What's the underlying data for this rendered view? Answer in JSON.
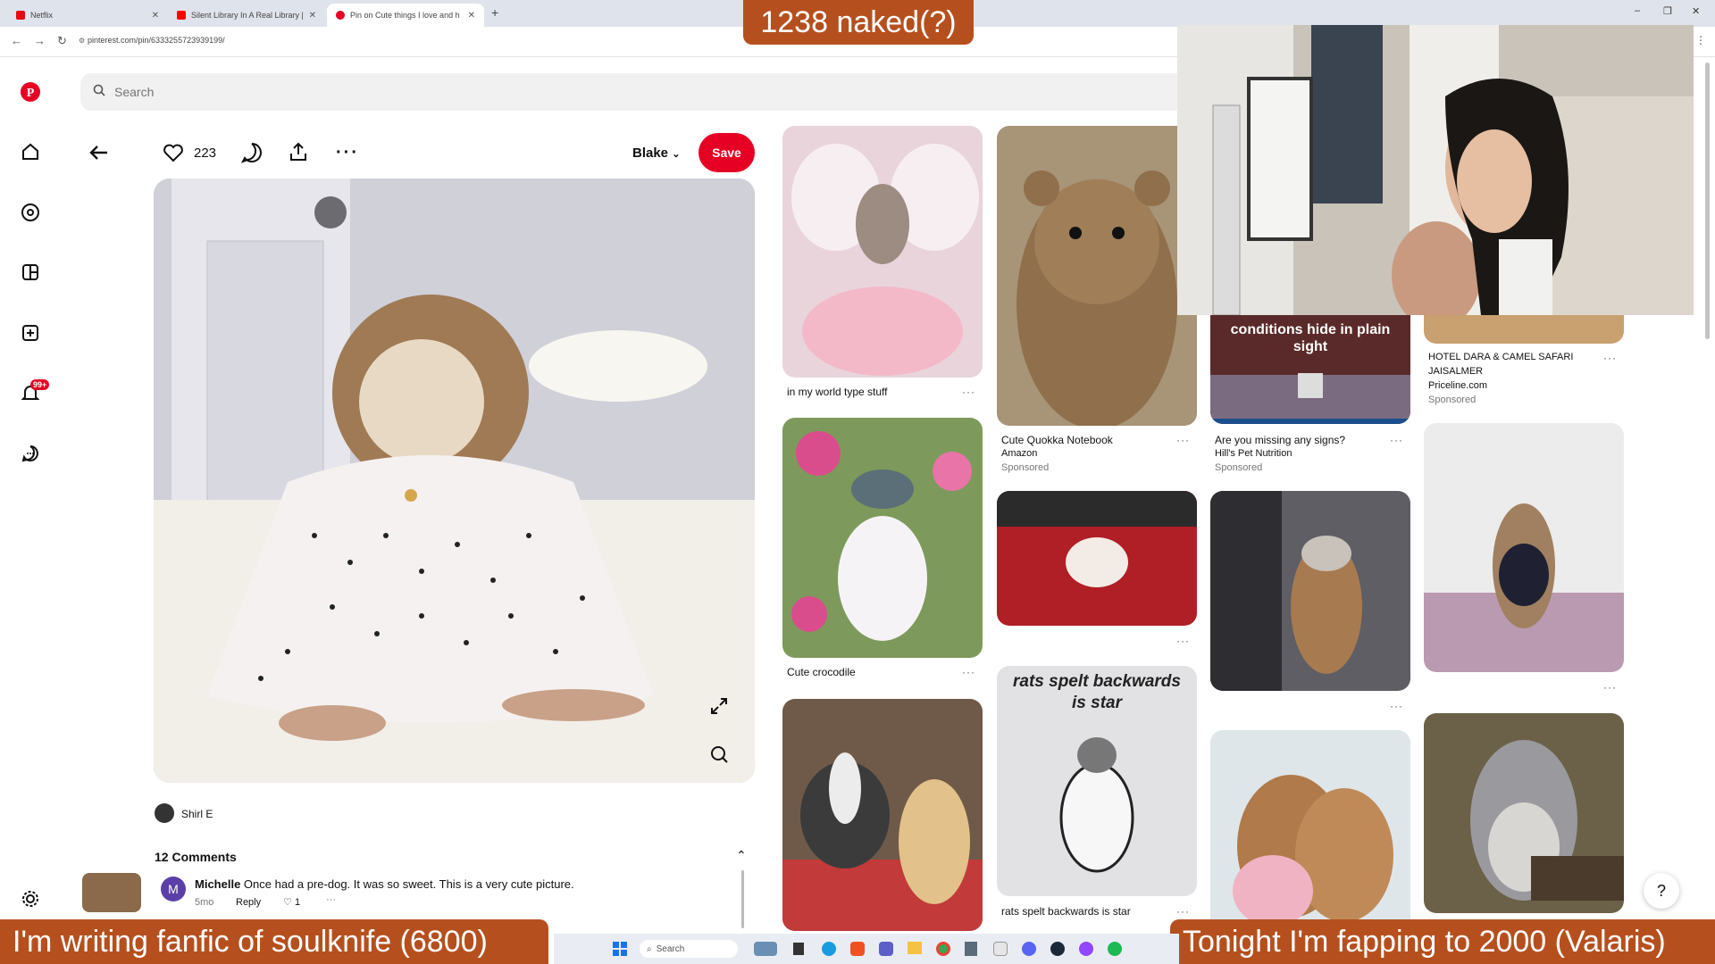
{
  "browser": {
    "tabs": [
      {
        "label": "Netflix",
        "color": "#e50914"
      },
      {
        "label": "Silent Library In A Real Library |",
        "color": "#ff0000"
      },
      {
        "label": "Pin on Cute things I love and h",
        "color": "#e60023"
      }
    ],
    "url": "pinterest.com/pin/63332557239391​99/"
  },
  "sidebar": {
    "notification_badge": "99+"
  },
  "search": {
    "placeholder": "Search"
  },
  "pin": {
    "like_count": "223",
    "board_name": "Blake",
    "save_label": "Save",
    "author": "Shirl E",
    "comments_heading": "12 Comments",
    "comment": {
      "avatar_letter": "M",
      "author": "Michelle",
      "text": "Once had a pre-dog. It was so sweet. This is a very cute picture.",
      "age": "5mo",
      "reply_label": "Reply",
      "likes": "1"
    }
  },
  "grid": {
    "col1": [
      {
        "caption": "in my world type stuff"
      },
      {
        "caption": "Cute crocodile"
      }
    ],
    "col2": [
      {
        "caption": "Cute Quokka Notebook",
        "source": "Amazon",
        "sponsored": "Sponsored"
      },
      {
        "overlay": "rats spelt backwards is star",
        "caption": "rats spelt backwards is star"
      }
    ],
    "col3": [
      {
        "overlay": "conditions hide in plain sight",
        "caption": "Are you missing any signs?",
        "source": "Hill's Pet Nutrition",
        "sponsored": "Sponsored"
      }
    ],
    "col4": [
      {
        "caption_line1": "HOTEL DARA & CAMEL SAFARI",
        "caption_line2": "JAISALMER",
        "source": "Priceline.com",
        "sponsored": "Sponsored"
      }
    ]
  },
  "overlays": {
    "top_banner": "1238 naked(?)",
    "bottom_left": "I'm writing fanfic of  soulknife (6800)",
    "bottom_right": "Tonight I'm fapping to 2000 (Valaris)"
  },
  "taskbar": {
    "search_placeholder": "Search"
  },
  "colors": {
    "brand": "#e60023",
    "banner": "#b5501e"
  }
}
